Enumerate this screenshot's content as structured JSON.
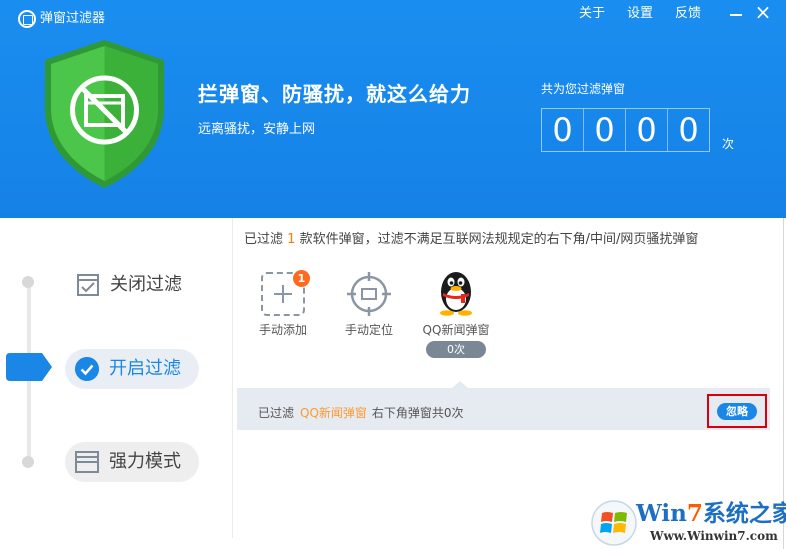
{
  "window": {
    "title": "弹窗过滤器",
    "menu": {
      "about": "关于",
      "settings": "设置",
      "feedback": "反馈"
    },
    "close_glyph": "×"
  },
  "header": {
    "slogan": "拦弹窗、防骚扰，就这么给力",
    "sub_slogan": "远离骚扰，安静上网",
    "count_label": "共为您过滤弹窗",
    "count_digits": [
      "0",
      "0",
      "0",
      "0"
    ],
    "count_unit": "次",
    "shield_icon": "blocked-window-shield-icon"
  },
  "modes": {
    "off_label": "关闭过滤",
    "on_label": "开启过滤",
    "strong_label": "强力模式",
    "active": "on"
  },
  "summary": {
    "prefix": "已过滤",
    "count": "1",
    "suffix": "款软件弹窗，过滤不满足互联网法规规定的右下角/中间/网页骚扰弹窗"
  },
  "tools": {
    "manual_add_label": "手动添加",
    "manual_add_badge": "1",
    "locate_label": "手动定位",
    "qq_label": "QQ新闻弹窗",
    "qq_count": "0次"
  },
  "record": {
    "prefix": "已过滤",
    "app_name": "QQ新闻弹窗",
    "detail": "右下角弹窗共0次",
    "ignore_label": "忽略"
  },
  "watermark": {
    "brand_prefix": "Win",
    "brand_seven": "7",
    "brand_suffix": "系统之家",
    "url": "Www.Winwin7.com"
  },
  "colors": {
    "header_blue": "#1a8ef0",
    "accent_blue": "#1a86e6",
    "shield_green": "#4cc64a",
    "highlight_orange": "#ff7a00",
    "badge_orange": "#ff6a1f",
    "highlight_frame_red": "#d9000c"
  }
}
